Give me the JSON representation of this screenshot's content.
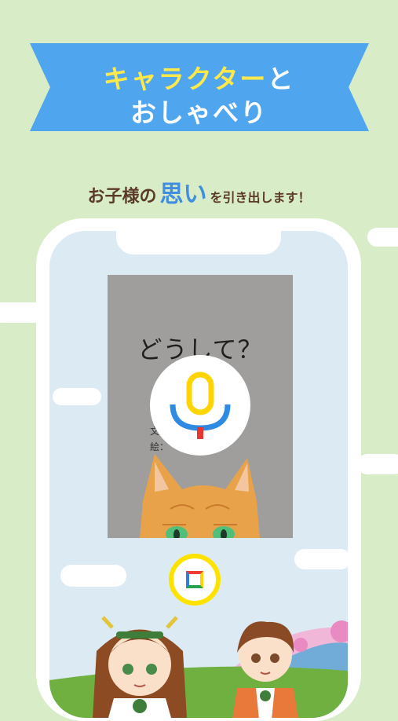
{
  "banner": {
    "line1_highlight": "キャラクター",
    "line1_rest": "と",
    "line2": "おしゃべり"
  },
  "tagline": {
    "part1": "お子様の",
    "highlight": "思い",
    "part2": "を引き出します！"
  },
  "book": {
    "title": "どうして？",
    "credit_text": "文：",
    "credit_art": "絵："
  },
  "colors": {
    "background": "#d8ecc7",
    "banner": "#4fa6ef",
    "accent_yellow": "#ffe94a",
    "brown_text": "#5b3a2a",
    "blue_text": "#3f8ee0"
  },
  "icons": {
    "mic": "microphone-icon",
    "stop": "stop-icon",
    "cat": "cat-illustration",
    "girl": "girl-character",
    "boy": "boy-character"
  }
}
